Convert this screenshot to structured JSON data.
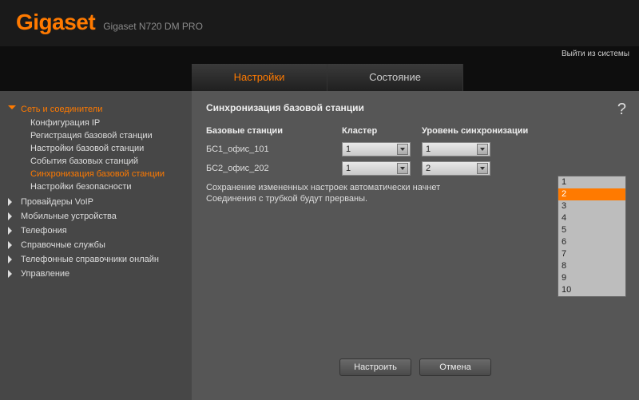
{
  "brand": "Gigaset",
  "model": "Gigaset N720 DM PRO",
  "logout": "Выйти из системы",
  "tabs": {
    "settings": "Настройки",
    "status": "Состояние"
  },
  "sidebar": {
    "net": {
      "label": "Сеть и соединители",
      "items": [
        "Конфигурация IP",
        "Регистрация базовой станции",
        "Настройки базовой станции",
        "События базовых станций",
        "Синхронизация базовой станции",
        "Настройки безопасности"
      ]
    },
    "groups": [
      "Провайдеры VoIP",
      "Мобильные устройства",
      "Телефония",
      "Справочные службы",
      "Телефонные справочники онлайн",
      "Управление"
    ]
  },
  "panel": {
    "title": "Синхронизация базовой станции",
    "cols": {
      "c1": "Базовые станции",
      "c2": "Кластер",
      "c3": "Уровень синхронизации"
    },
    "rows": [
      {
        "name": "БС1_офис_101",
        "cluster": "1",
        "level": "1"
      },
      {
        "name": "БС2_офис_202",
        "cluster": "1",
        "level": "2"
      }
    ],
    "note1": "Сохранение измененных настроек автоматически начнет",
    "note2": "Соединения с трубкой будут прерваны.",
    "dropdown": [
      "1",
      "2",
      "3",
      "4",
      "5",
      "6",
      "7",
      "8",
      "9",
      "10"
    ],
    "dropdown_selected": "2",
    "buttons": {
      "ok": "Настроить",
      "cancel": "Отмена"
    },
    "help": "?"
  }
}
